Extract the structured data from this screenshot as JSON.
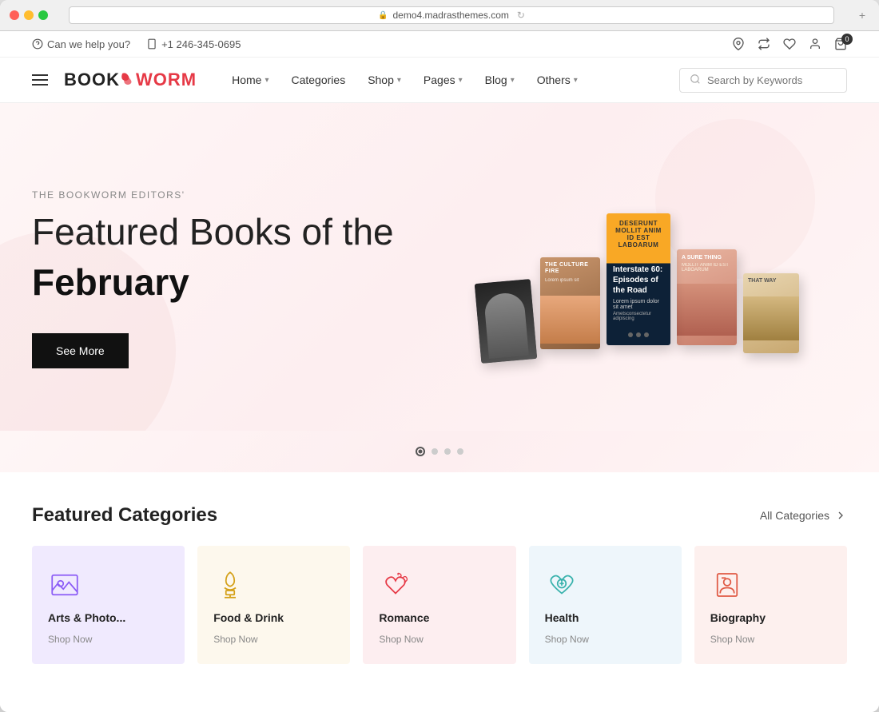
{
  "browser": {
    "url": "demo4.madrasthemes.com",
    "dots": [
      "red",
      "yellow",
      "green"
    ],
    "new_tab_label": "+"
  },
  "topbar": {
    "help_label": "Can we help you?",
    "phone": "+1 246-345-0695",
    "cart_count": "0"
  },
  "logo": {
    "book": "BOOK",
    "worm": "WORM"
  },
  "nav": {
    "items": [
      {
        "label": "Home",
        "has_dropdown": true
      },
      {
        "label": "Categories",
        "has_dropdown": false
      },
      {
        "label": "Shop",
        "has_dropdown": true
      },
      {
        "label": "Pages",
        "has_dropdown": true
      },
      {
        "label": "Blog",
        "has_dropdown": true
      },
      {
        "label": "Others",
        "has_dropdown": true
      }
    ],
    "search_placeholder": "Search by Keywords"
  },
  "hero": {
    "subtitle": "THE BOOKWORM EDITORS'",
    "title_line1": "Featured Books of the",
    "title_line2": "February",
    "cta_label": "See More",
    "slide_count": 4,
    "active_slide": 0
  },
  "categories": {
    "section_title": "Featured Categories",
    "all_label": "All Categories",
    "items": [
      {
        "name": "Arts & Photo...",
        "shop_label": "Shop Now",
        "bg": "purple",
        "icon": "arts"
      },
      {
        "name": "Food & Drink",
        "shop_label": "Shop Now",
        "bg": "yellow",
        "icon": "food"
      },
      {
        "name": "Romance",
        "shop_label": "Shop Now",
        "bg": "pink",
        "icon": "romance"
      },
      {
        "name": "Health",
        "shop_label": "Shop Now",
        "bg": "blue",
        "icon": "health"
      },
      {
        "name": "Biography",
        "shop_label": "Shop Now",
        "bg": "red",
        "icon": "bio"
      }
    ]
  }
}
